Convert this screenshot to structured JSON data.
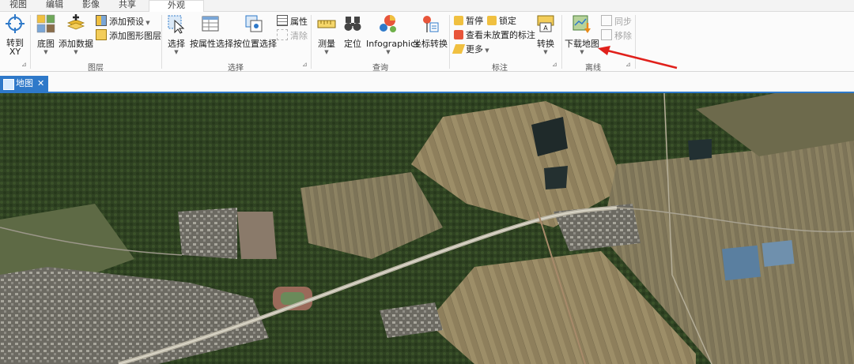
{
  "ribbon_tabs": [
    {
      "label": "视图"
    },
    {
      "label": "编辑"
    },
    {
      "label": "影像"
    },
    {
      "label": "共享"
    },
    {
      "label": "外观"
    }
  ],
  "buttons": {
    "goto_xy": "转到\nXY",
    "basemap": "底图",
    "add_data": "添加数据",
    "add_preset": "添加预设",
    "add_graphics_layer": "添加图形图层",
    "select": "选择",
    "select_by_attributes": "按属性选择",
    "select_by_location": "按位置选择",
    "attributes": "属性",
    "clear": "清除",
    "measure": "测量",
    "locate": "定位",
    "infographics": "Infographics",
    "convert_coordinates": "坐标转换",
    "pause": "暂停",
    "lock": "锁定",
    "view_unplaced": "查看未放置的标注",
    "more": "更多",
    "convert": "转换",
    "download_map": "下载地图",
    "sync": "同步",
    "remove": "移除"
  },
  "group_labels": {
    "layer": "图层",
    "selection": "选择",
    "inquiry": "查询",
    "labeling": "标注",
    "offline": "离线"
  },
  "doc_tab": {
    "label": "地图"
  },
  "colors": {
    "accent": "#2e79c9",
    "arrow": "#e0201b"
  }
}
